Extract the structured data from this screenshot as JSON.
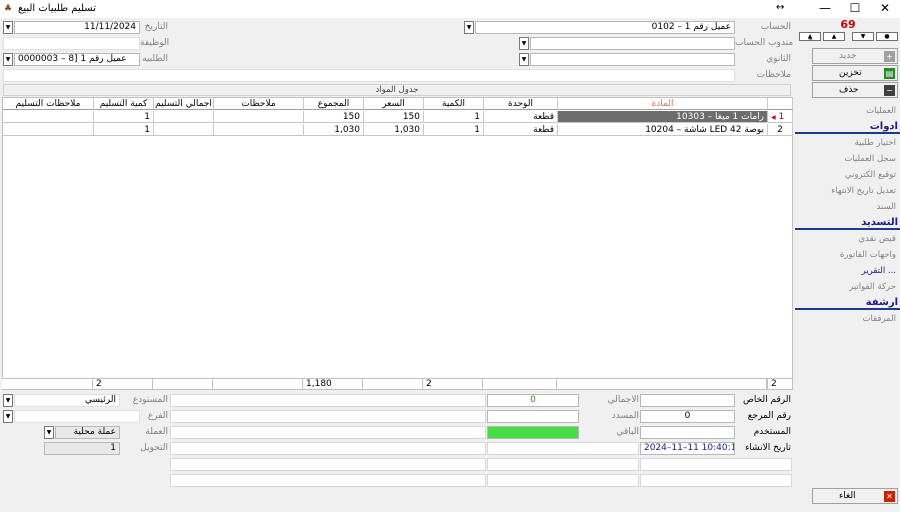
{
  "window": {
    "title": "تسليم طلبيات البيع",
    "minimize": "—",
    "maximize": "☐",
    "close": "✕"
  },
  "header": {
    "date_label": "التاريخ",
    "date_value": "11/11/2024",
    "job_label": "الوظيفة",
    "job_value": "",
    "order_label": "الطلبيه",
    "order_value": "0000003 – عميل رقم 1 [8",
    "account_label": "الحساب",
    "account_value": "0102 – عميل رقم 1",
    "rep_label": "مندوب الحساب",
    "rep_value": "",
    "secondary_label": "الثانوي",
    "secondary_value": "",
    "notes_label": "ملاحظات",
    "notes_value": ""
  },
  "grid": {
    "caption": "جدول المواد",
    "columns": [
      "المادة",
      "الوحدة",
      "الكمية",
      "السعر",
      "المجموع",
      "ملاحظات",
      "اجمالي التسليم",
      "كمية التسليم",
      "ملاحظات التسليم"
    ],
    "rows": [
      {
        "no": "1",
        "item": "10303 – رامات 1 ميغا",
        "unit": "قطعة",
        "qty": "1",
        "price": "150",
        "total": "150",
        "notes": "",
        "delivered_total": "",
        "delivered_qty": "1",
        "delivery_notes": ""
      },
      {
        "no": "2",
        "item": "10204 – شاشة LED 42 بوصة",
        "unit": "قطعة",
        "qty": "1",
        "price": "1,030",
        "total": "1,030",
        "notes": "",
        "delivered_total": "",
        "delivered_qty": "1",
        "delivery_notes": ""
      }
    ],
    "totals": {
      "count": "2",
      "qty": "2",
      "total": "1,180",
      "delivered_qty": "2"
    }
  },
  "footer": {
    "private_no_label": "الرقم الخاص",
    "private_no_value": "",
    "ref_no_label": "رقم المرجع",
    "ref_no_value": "0",
    "user_label": "المستخدم",
    "user_value": "",
    "created_label": "تاريخ الانشاء",
    "created_value": "2024–11–11 10:40:11",
    "total_label": "الاجمالي",
    "total_value": "0",
    "paid_label": "المسدد",
    "paid_value": "",
    "remaining_label": "الباقي",
    "remaining_value": "",
    "warehouse_label": "المستودع",
    "warehouse_value": "الرئيسي",
    "branch_label": "الفرع",
    "branch_value": "",
    "currency_label": "العملة",
    "currency_value": "عملة محلية",
    "conversion_label": "التحويل",
    "conversion_value": "1"
  },
  "sidebar": {
    "record_counter": "69",
    "new_label": "جديد",
    "save_label": "تخزين",
    "delete_label": "حذف",
    "operations_label": "العمليات",
    "tools_header": "ادوات",
    "tools": [
      "اختيار طلبية",
      "سجل العمليات",
      "توقيع الكتروني",
      "تعديل تاريخ الانتهاء",
      "السند"
    ],
    "payment_header": "التسديد",
    "payment": [
      "قبض نقدي",
      "واجهات الفاتورة",
      "التقرير ...",
      "حركة الفواتير"
    ],
    "archive_header": "ارشفة",
    "archive": [
      "المرفقات"
    ],
    "cancel_label": "الغاء"
  },
  "colors": {
    "selected_row": "#6d6d6d",
    "remaining_fill": "#44dd44",
    "header_link": "#1a1a8a",
    "counter": "#cc0000"
  }
}
